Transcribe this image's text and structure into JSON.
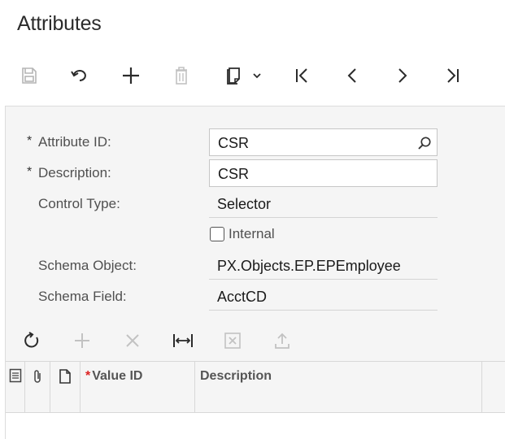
{
  "page": {
    "title": "Attributes"
  },
  "toolbar": {
    "save": "save-icon",
    "undo": "undo-icon",
    "add": "plus-icon",
    "delete": "trash-icon",
    "copy_paste": "clipboard-icon",
    "first": "first-record-icon",
    "prev": "previous-icon",
    "next": "next-icon",
    "last": "last-record-icon"
  },
  "form": {
    "attribute_id": {
      "required": "*",
      "label": "Attribute ID:",
      "value": "CSR"
    },
    "description": {
      "required": "*",
      "label": "Description:",
      "value": "CSR"
    },
    "control_type": {
      "label": "Control Type:",
      "value": "Selector"
    },
    "internal": {
      "label": "Internal",
      "checked": false
    },
    "schema_object": {
      "label": "Schema Object:",
      "value": "PX.Objects.EP.EPEmployee"
    },
    "schema_field": {
      "label": "Schema Field:",
      "value": "AcctCD"
    }
  },
  "grid": {
    "toolbar": [
      "refresh-icon",
      "add-row-icon",
      "delete-row-icon",
      "fit-columns-icon",
      "export-excel-icon",
      "upload-icon"
    ],
    "columns": {
      "value_id": {
        "required": "*",
        "label": "Value ID"
      },
      "description": "Description"
    }
  },
  "colors": {
    "background": "#f5f5f5",
    "required": "#dd2222",
    "text": "#222222"
  }
}
